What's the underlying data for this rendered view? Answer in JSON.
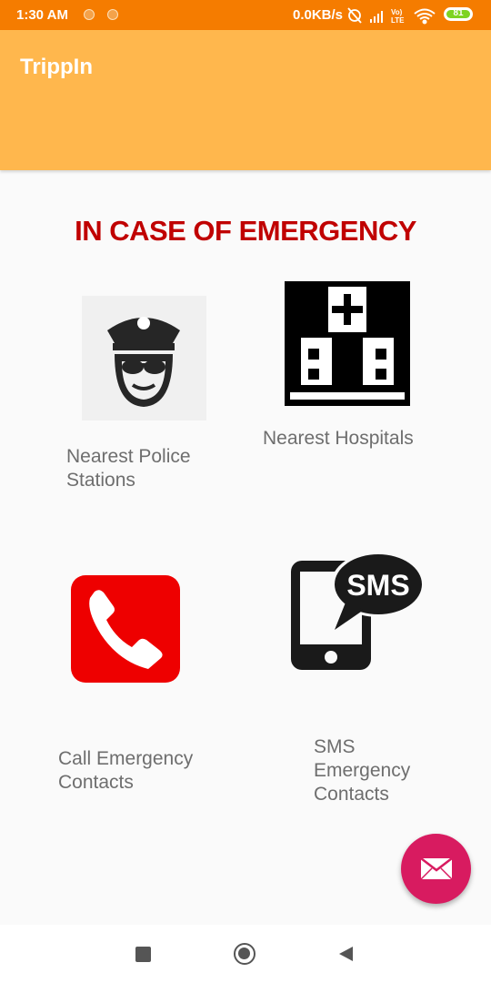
{
  "status_bar": {
    "time": "1:30 AM",
    "network_speed": "0.0KB/s",
    "battery_level": "81"
  },
  "app_bar": {
    "title": "TrippIn"
  },
  "main": {
    "heading": "IN CASE OF EMERGENCY",
    "options": [
      {
        "label": "Nearest Police Stations",
        "icon": "police-officer-icon"
      },
      {
        "label": "Nearest Hospitals",
        "icon": "hospital-icon"
      },
      {
        "label": "Call Emergency Contacts",
        "icon": "phone-call-icon"
      },
      {
        "label": "SMS Emergency Contacts",
        "icon": "sms-phone-icon"
      }
    ],
    "sms_badge_text": "SMS"
  },
  "fab": {
    "icon": "mail-icon",
    "color": "#d81b60"
  },
  "colors": {
    "status_bar": "#f57c00",
    "app_bar": "#ffb74d",
    "heading": "#c00000"
  }
}
